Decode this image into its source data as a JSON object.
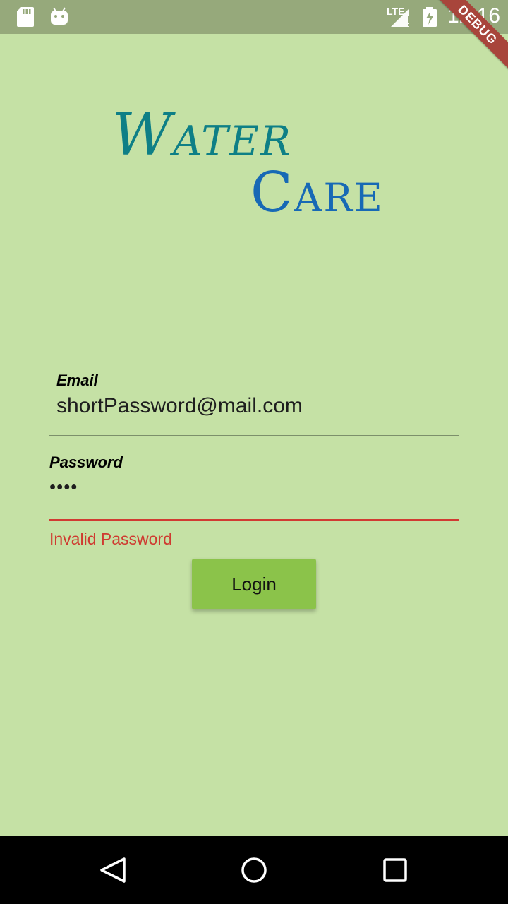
{
  "status_bar": {
    "time": "12:16",
    "network": "LTE",
    "icons": [
      "sd-card-icon",
      "android-icon",
      "signal-icon",
      "battery-charging-icon"
    ]
  },
  "debug_banner": "DEBUG",
  "logo": {
    "line1": "Water",
    "line2": "Care",
    "colors": {
      "line1": "#0e7f86",
      "line2": "#1769b5"
    }
  },
  "form": {
    "email": {
      "label": "Email",
      "value": "shortPassword@mail.com"
    },
    "password": {
      "label": "Password",
      "value": "••••",
      "error": "Invalid Password"
    },
    "login_label": "Login"
  },
  "nav_bar": {
    "icons": [
      "back-icon",
      "home-icon",
      "recents-icon"
    ]
  },
  "colors": {
    "background": "#c5e1a5",
    "status_bar": "#96a97b",
    "button": "#8bc34a",
    "error": "#cf3a30"
  }
}
